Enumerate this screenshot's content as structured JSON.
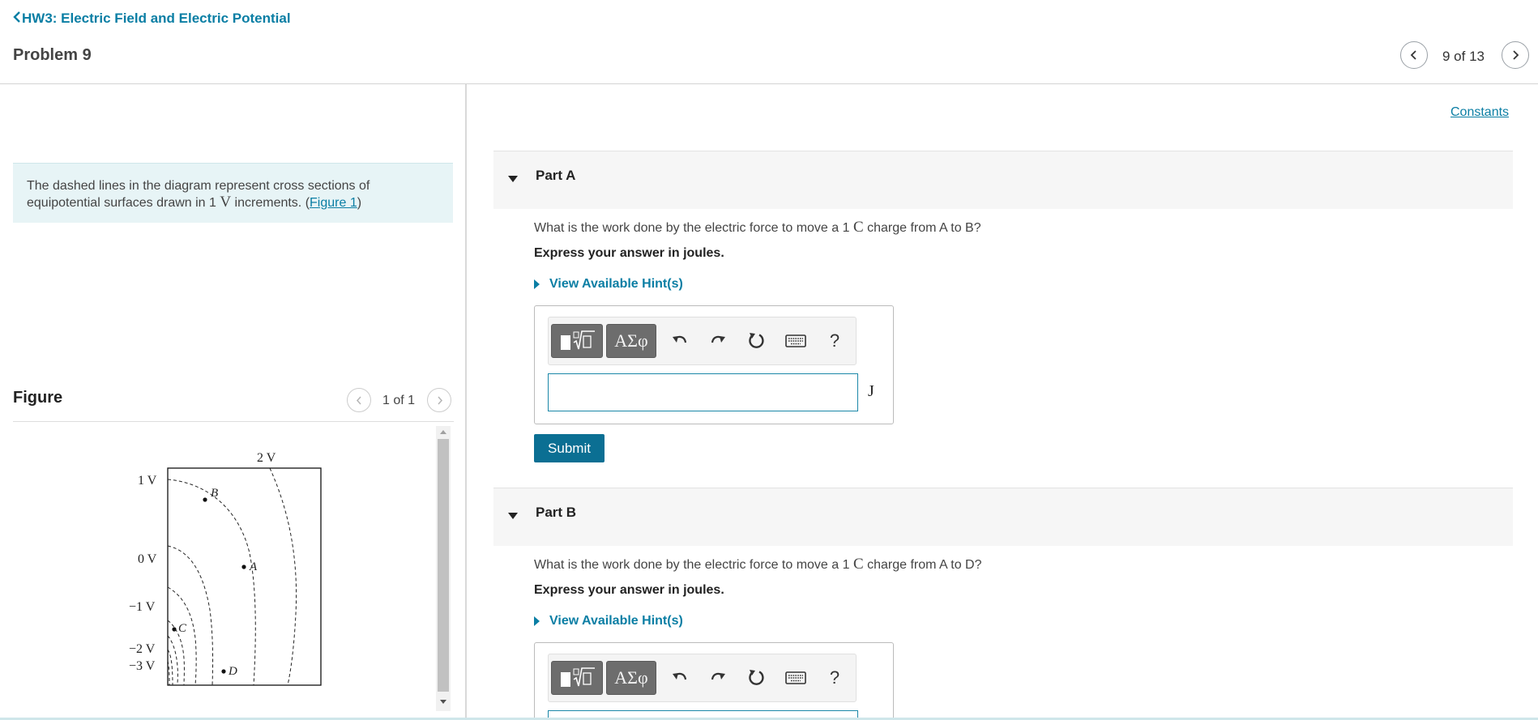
{
  "header": {
    "back_link": "HW3: Electric Field and Electric Potential",
    "problem_title": "Problem 9",
    "page_count": "9 of 13"
  },
  "intro": {
    "text_before": "The dashed lines in the diagram represent cross sections of equipotential surfaces drawn in 1 ",
    "unit_symbol": "V",
    "text_after": " increments. (",
    "figure_link": "Figure 1",
    "text_end": ")"
  },
  "figure": {
    "label": "Figure",
    "count": "1 of 1",
    "diagram": {
      "labels": {
        "top_right": "2 V",
        "v1": "1 V",
        "v0": "0 V",
        "vm1": "−1 V",
        "vm2": "−2 V",
        "vm3": "−3 V"
      },
      "points": {
        "B": "B",
        "A": "A",
        "C": "C",
        "D": "D"
      }
    }
  },
  "constants_link": "Constants",
  "partA": {
    "title": "Part A",
    "question_before": "What is the work done by the electric force to move a 1 ",
    "question_unit": "C",
    "question_after": " charge from A to B?",
    "express": "Express your answer in joules.",
    "hint": "View Available Hint(s)",
    "unit": "J",
    "submit": "Submit"
  },
  "partB": {
    "title": "Part B",
    "question_before": "What is the work done by the electric force to move a 1 ",
    "question_unit": "C",
    "question_after": " charge from A to D?",
    "express": "Express your answer in joules.",
    "hint": "View Available Hint(s)"
  },
  "toolbar": {
    "greek_label": "ΑΣφ",
    "help_label": "?",
    "icons": [
      "templates-icon",
      "undo-icon",
      "redo-icon",
      "reset-icon",
      "keyboard-icon",
      "help-icon"
    ]
  },
  "colors": {
    "link": "#0a7ea4",
    "submit": "#0b6f93",
    "intro_bg": "#e7f4f6",
    "input_border": "#1b87a8"
  }
}
